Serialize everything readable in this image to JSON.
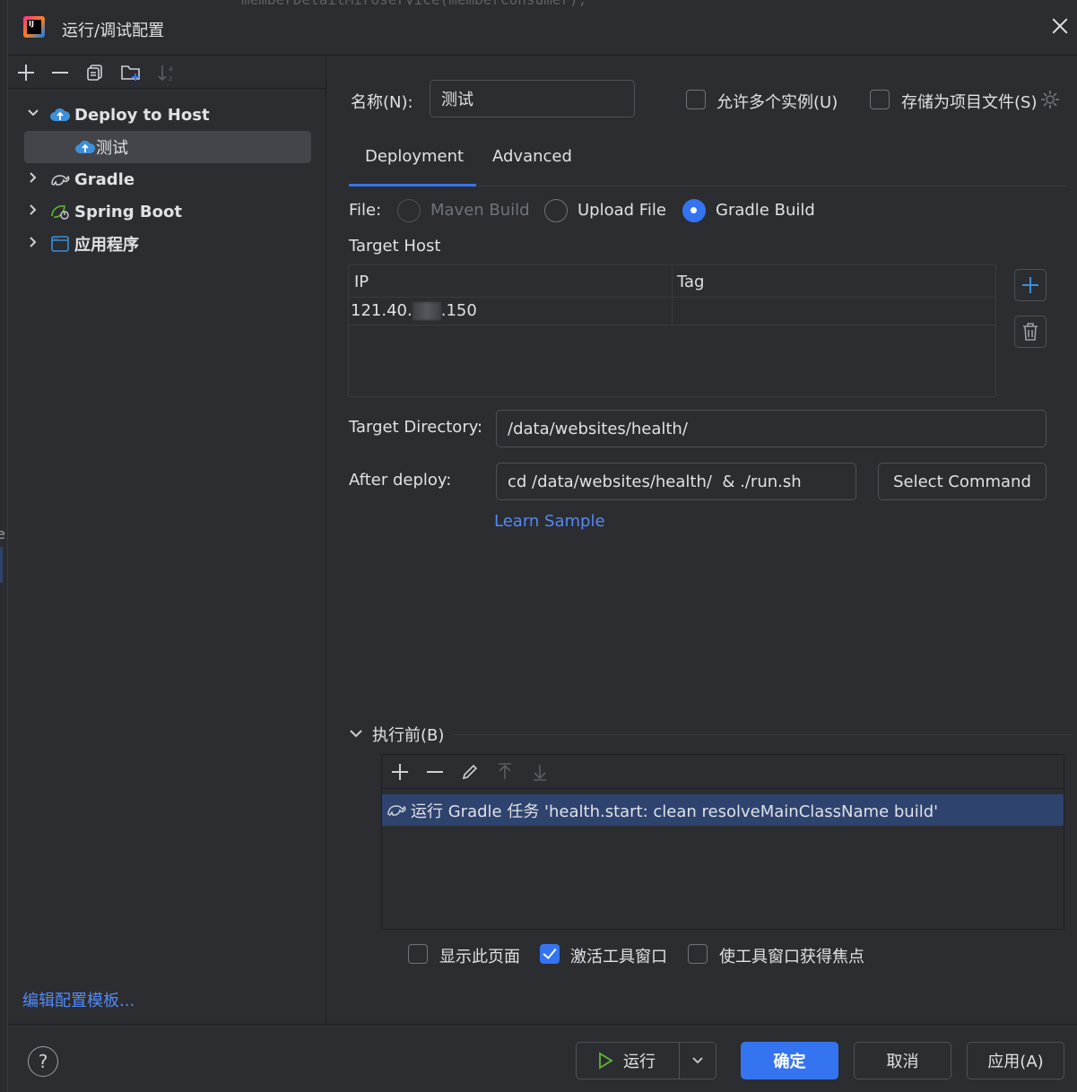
{
  "background_code": "memberDetailMiroservice(memberConsumer);",
  "edge_text": "e",
  "window": {
    "title": "运行/调试配置",
    "logo_text": "IJ"
  },
  "left_toolbar": {
    "add_icon": "plus-icon",
    "remove_icon": "minus-icon",
    "copy_icon": "copy-icon",
    "folder_icon": "new-folder-icon",
    "sort_icon": "sort-alpha-icon"
  },
  "tree": {
    "items": [
      {
        "label": "Deploy to Host",
        "expanded": true,
        "icon": "cloud-upload-icon"
      },
      {
        "label": "测试",
        "selected": true,
        "icon": "cloud-upload-icon"
      },
      {
        "label": "Gradle",
        "expanded": false,
        "icon": "gradle-icon"
      },
      {
        "label": "Spring Boot",
        "expanded": false,
        "icon": "spring-boot-icon"
      },
      {
        "label": "应用程序",
        "expanded": false,
        "icon": "application-icon"
      }
    ]
  },
  "edit_templates_link": "编辑配置模板...",
  "form": {
    "name_label": "名称(N):",
    "name_value": "测试",
    "allow_multiple_label": "允许多个实例(U)",
    "allow_multiple_checked": false,
    "store_as_file_label": "存储为项目文件(S)",
    "store_as_file_checked": false
  },
  "tabs": [
    {
      "label": "Deployment",
      "active": true
    },
    {
      "label": "Advanced",
      "active": false
    }
  ],
  "file": {
    "label": "File:",
    "options": [
      {
        "label": "Maven Build",
        "selected": false,
        "disabled": true
      },
      {
        "label": "Upload File",
        "selected": false,
        "disabled": false
      },
      {
        "label": "Gradle Build",
        "selected": true,
        "disabled": false
      }
    ]
  },
  "target_host": {
    "label": "Target Host",
    "columns": [
      "IP",
      "Tag"
    ],
    "rows": [
      {
        "ip_prefix": "121.40.",
        "ip_suffix": ".150",
        "tag": ""
      }
    ]
  },
  "target_directory": {
    "label": "Target Directory:",
    "value": "/data/websites/health/"
  },
  "after_deploy": {
    "label": "After deploy:",
    "value": "cd /data/websites/health/  & ./run.sh"
  },
  "select_command_label": "Select Command",
  "learn_sample_label": "Learn Sample",
  "before_launch": {
    "label": "执行前(B)",
    "tasks": [
      {
        "label": "运行 Gradle 任务 'health.start: clean resolveMainClassName build'",
        "icon": "gradle-icon"
      }
    ]
  },
  "options": [
    {
      "label": "显示此页面",
      "checked": false
    },
    {
      "label": "激活工具窗口",
      "checked": true
    },
    {
      "label": "使工具窗口获得焦点",
      "checked": false
    }
  ],
  "footer": {
    "help": "?",
    "run_label": "运行",
    "ok_label": "确定",
    "cancel_label": "取消",
    "apply_label": "应用(A)"
  },
  "colors": {
    "accent": "#3574f0",
    "link": "#548af7",
    "selection": "#2e436e",
    "background": "#2b2d30"
  }
}
